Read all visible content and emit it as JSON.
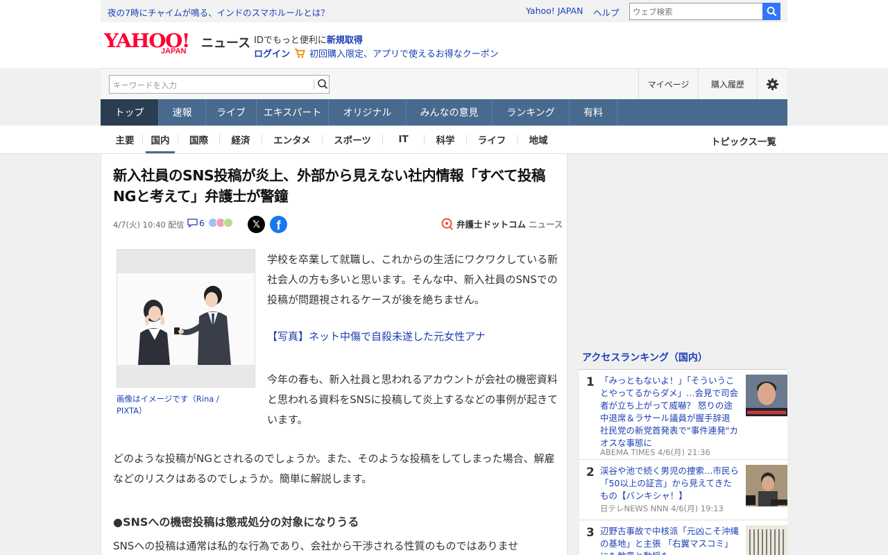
{
  "topbar": {
    "promo": "夜の7時にチャイムが鳴る、インドのスマホルールとは？",
    "yahoo_japan": "Yahoo! JAPAN",
    "help": "ヘルプ",
    "web_search_placeholder": "ウェブ検索"
  },
  "logo": {
    "yahoo": "YAHOO!",
    "japan": "JAPAN",
    "news": "ニュース"
  },
  "account": {
    "id_prefix": "IDでもっと便利に",
    "signup": "新規取得",
    "login": "ログイン",
    "coupon": "初回購入限定、アプリで使えるお得なクーポン"
  },
  "search": {
    "placeholder": "キーワードを入力",
    "mypage": "マイページ",
    "history": "購入履歴"
  },
  "nav": [
    "トップ",
    "速報",
    "ライブ",
    "エキスパート",
    "オリジナル",
    "みんなの意見",
    "ランキング",
    "有料"
  ],
  "subnav": [
    "主要",
    "国内",
    "国際",
    "経済",
    "エンタメ",
    "スポーツ",
    "IT",
    "科学",
    "ライフ",
    "地域"
  ],
  "subnav_topics": "トピックス一覧",
  "article": {
    "headline": "新入社員のSNS投稿が炎上、外部から見えない社内情報「すべて投稿NGと考えて」弁護士が警鐘",
    "date": "4/7(火) 10:40 配信",
    "comments": "6",
    "source_name": "弁護士ドットコム",
    "source_news": "ニュース",
    "photo_caption": "画像はイメージです（Rina / PIXTA）",
    "para1": "学校を卒業して就職し、これからの生活にワクワクしている新社会人の方も多いと思います。そんな中、新入社員のSNSでの投稿が問題視されるケースが後を絶ちません。",
    "photo_link": "【写真】ネット中傷で自殺未遂した元女性アナ",
    "para2": "今年の春も、新入社員と思われるアカウントが会社の機密資料と思われる資料をSNSに投稿して炎上するなどの事例が起きています。",
    "para3": "どのような投稿がNGとされるのでしょうか。また、そのような投稿をしてしまった場合、解雇などのリスクはあるのでしょうか。簡単に解説します。",
    "subhead": "●SNSへの機密投稿は懲戒処分の対象になりうる",
    "para4": "SNSへの投稿は通常は私的な行為であり、会社から干渉される性質のものではありませ"
  },
  "ranking": {
    "title": "アクセスランキング（国内）",
    "items": [
      {
        "rank": "1",
        "text": "「みっともないよ！」「そういうことやってるからダメ」…会見で司会者が立ち上がって威嚇？ 怒りの途中退席＆ラサール議員が握手辞退 社民党の新党首発表で\"事件連発\"カオスな事態に",
        "source": "ABEMA TIMES 4/6(月) 21:36"
      },
      {
        "rank": "2",
        "text": "渓谷や池で続く男児の捜索…市民ら「50以上の証言」から見えてきたもの【バンキシャ！】",
        "source": "日テレNEWS NNN 4/6(月) 19:13"
      },
      {
        "rank": "3",
        "text": "辺野古事故で中核派「元凶こそ沖縄の基地」と主張 「右翼マスコミ」にも敵意と動揺も",
        "source": ""
      }
    ]
  },
  "colors": {
    "accent": "#1a3fb3",
    "nav": "#486a8e",
    "nav_active": "#2b3d50",
    "brand_red": "#ff0033"
  }
}
